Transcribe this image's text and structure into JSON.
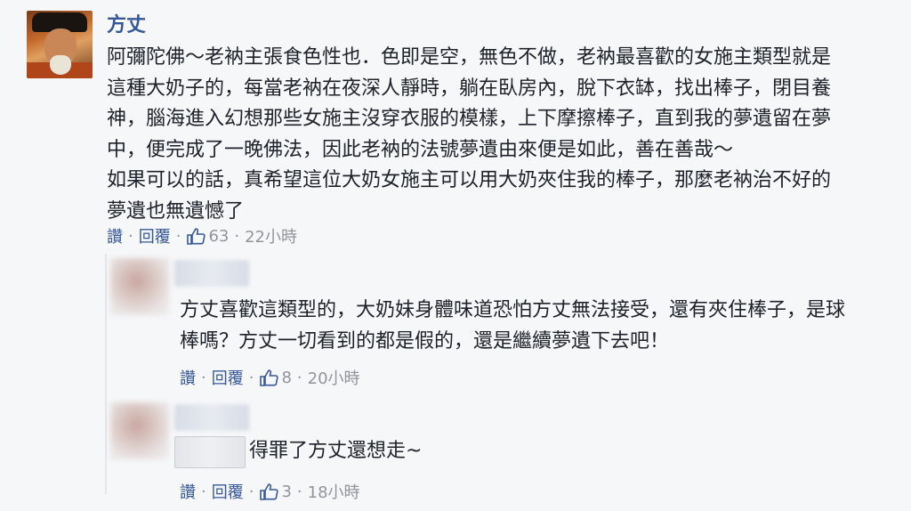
{
  "main_comment": {
    "author": "方丈",
    "lines": [
      "阿彌陀佛～老衲主張食色性也．色即是空，無色不做，老衲最喜歡的女施主類型就是",
      "這種大奶子的，每當老衲在夜深人靜時，躺在臥房內，脫下衣缽，找出棒子，閉目養",
      "神，腦海進入幻想那些女施主沒穿衣服的模樣，上下摩擦棒子，直到我的夢遺留在夢",
      "中，便完成了一晚佛法，因此老衲的法號夢遺由來便是如此，善在善哉～",
      "如果可以的話，真希望這位大奶女施主可以用大奶夾住我的棒子，那麼老衲治不好的",
      "夢遺也無遺憾了"
    ],
    "actions": {
      "like_label": "讚",
      "reply_label": "回覆",
      "like_count": "63",
      "time": "22小時"
    }
  },
  "reply_1": {
    "lines": [
      "方丈喜歡這類型的，大奶妹身體味道恐怕方丈無法接受，還有夾住棒子，是球",
      "棒嗎？方丈一切看到的都是假的，還是繼續夢遺下去吧！"
    ],
    "actions": {
      "like_label": "讚",
      "reply_label": "回覆",
      "like_count": "8",
      "time": "20小時"
    }
  },
  "reply_2": {
    "text": "得罪了方丈還想走~",
    "actions": {
      "like_label": "讚",
      "reply_label": "回覆",
      "like_count": "3",
      "time": "18小時"
    }
  },
  "colors": {
    "link": "#365899",
    "meta_gray": "#90949c",
    "background": "#f6f7f9"
  }
}
